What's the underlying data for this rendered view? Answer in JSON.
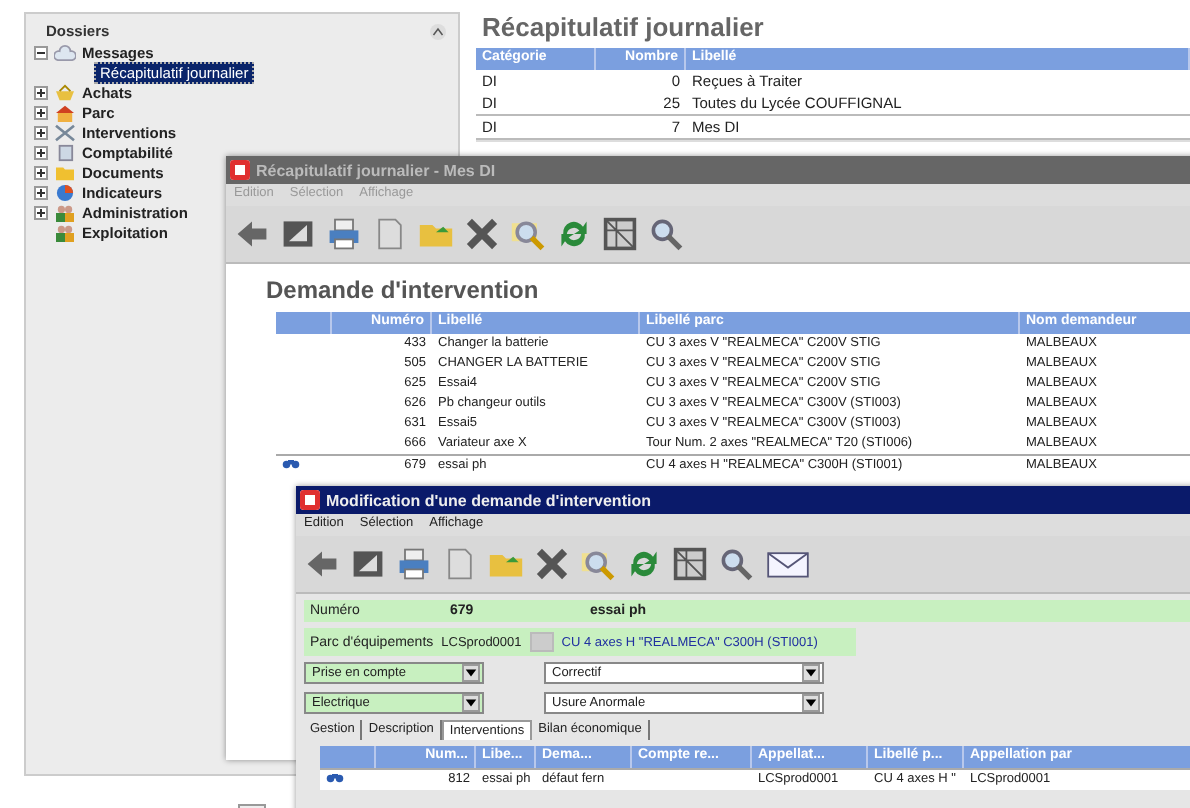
{
  "sidebar": {
    "title": "Dossiers",
    "items": [
      {
        "label": "Messages",
        "expanded": true,
        "children": [
          {
            "label": "Récapitulatif journalier",
            "selected": true
          }
        ]
      },
      {
        "label": "Achats",
        "expanded": false
      },
      {
        "label": "Parc",
        "expanded": false
      },
      {
        "label": "Interventions",
        "expanded": false
      },
      {
        "label": "Comptabilité",
        "expanded": false
      },
      {
        "label": "Documents",
        "expanded": false
      },
      {
        "label": "Indicateurs",
        "expanded": false
      },
      {
        "label": "Administration",
        "expanded": false
      },
      {
        "label": "Exploitation"
      }
    ]
  },
  "summary": {
    "title": "Récapitulatif journalier",
    "columns": [
      "Catégorie",
      "Nombre",
      "Libellé"
    ],
    "rows": [
      {
        "cells": [
          "DI",
          "0",
          "Reçues à Traiter"
        ],
        "current": false
      },
      {
        "cells": [
          "DI",
          "25",
          "Toutes du Lycée COUFFIGNAL"
        ],
        "current": false
      },
      {
        "cells": [
          "DI",
          "7",
          "Mes DI"
        ],
        "current": true
      }
    ]
  },
  "list_window": {
    "title": "Récapitulatif journalier - Mes DI",
    "menu": [
      "Edition",
      "Sélection",
      "Affichage"
    ],
    "heading": "Demande d'intervention",
    "columns": [
      "Numéro",
      "Libellé",
      "Libellé parc",
      "Nom demandeur"
    ],
    "rows": [
      {
        "cells": [
          "433",
          "Changer la batterie",
          "CU 3 axes V \"REALMECA\" C200V STIG",
          "MALBEAUX"
        ],
        "current": false
      },
      {
        "cells": [
          "505",
          "CHANGER LA BATTERIE",
          "CU 3 axes V \"REALMECA\" C200V STIG",
          "MALBEAUX"
        ],
        "current": false
      },
      {
        "cells": [
          "625",
          "Essai4",
          "CU 3 axes V \"REALMECA\" C200V STIG",
          "MALBEAUX"
        ],
        "current": false
      },
      {
        "cells": [
          "626",
          "Pb changeur outils",
          "CU 3 axes V \"REALMECA\" C300V (STI003)",
          "MALBEAUX"
        ],
        "current": false
      },
      {
        "cells": [
          "631",
          "Essai5",
          "CU 3 axes V \"REALMECA\" C300V (STI003)",
          "MALBEAUX"
        ],
        "current": false
      },
      {
        "cells": [
          "666",
          "Variateur axe X",
          "Tour Num. 2 axes \"REALMECA\" T20 (STI006)",
          "MALBEAUX"
        ],
        "current": false
      },
      {
        "cells": [
          "679",
          "essai ph",
          "CU 4 axes H \"REALMECA\" C300H (STI001)",
          "MALBEAUX"
        ],
        "current": true
      }
    ]
  },
  "edit_window": {
    "title": "Modification d'une demande d'intervention",
    "menu": [
      "Edition",
      "Sélection",
      "Affichage"
    ],
    "numero_label": "Numéro",
    "numero": "679",
    "libelle": "essai ph",
    "parc_label": "Parc d'équipements",
    "parc_code": "LCSprod0001",
    "parc_name": "CU 4 axes H \"REALMECA\" C300H (STI001)",
    "selects": [
      "Prise en compte",
      "Correctif",
      "Electrique",
      "Usure Anormale"
    ],
    "tabs": [
      {
        "label": "Gestion",
        "selected": false
      },
      {
        "label": "Description",
        "selected": false
      },
      {
        "label": "Interventions",
        "selected": true
      },
      {
        "label": "Bilan économique",
        "selected": false
      }
    ],
    "columns": [
      "Num...",
      "Libe...",
      "Dema...",
      "Compte re...",
      "Appellat...",
      "Libellé p...",
      "Appellation par"
    ],
    "rows": [
      {
        "current": true,
        "cells": [
          "812",
          "essai ph",
          "défaut fern",
          null,
          "LCSprod0001",
          "CU 4 axes H \"",
          "LCSprod0001"
        ]
      }
    ]
  }
}
